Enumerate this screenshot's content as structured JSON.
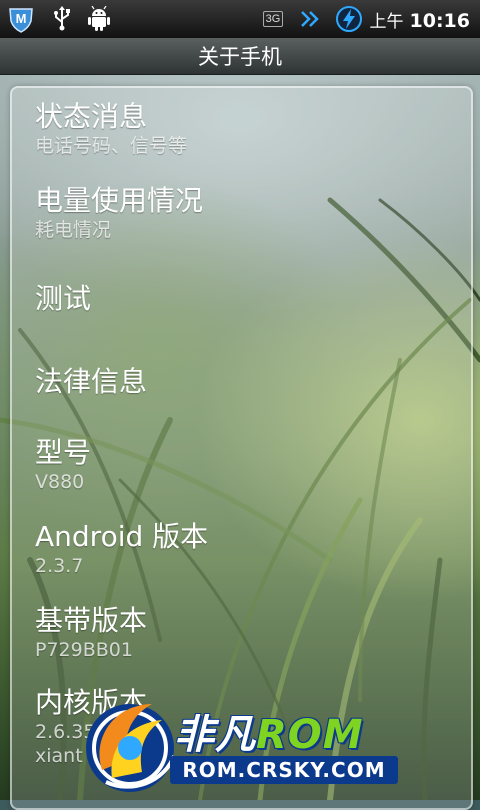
{
  "status_bar": {
    "network_label": "3G",
    "clock_ampm": "上午",
    "clock_time": "10:16",
    "icons": [
      "security-m-icon",
      "usb-icon",
      "android-debug-icon",
      "3g-signal-icon",
      "data-arrows-icon",
      "battery-charging-icon"
    ]
  },
  "title_bar": {
    "title": "关于手机"
  },
  "list": {
    "items": [
      {
        "title": "状态消息",
        "subtitle": "电话号码、信号等"
      },
      {
        "title": "电量使用情况",
        "subtitle": "耗电情况"
      },
      {
        "title": "测试",
        "subtitle": ""
      },
      {
        "title": "法律信息",
        "subtitle": ""
      },
      {
        "title": "型号",
        "subtitle": "V880"
      },
      {
        "title": "Android 版本",
        "subtitle": "2.3.7"
      },
      {
        "title": "基带版本",
        "subtitle": "P729BB01"
      },
      {
        "title": "内核版本",
        "subtitle": "2.6.35",
        "subtitle2": "xiant"
      }
    ]
  },
  "watermark": {
    "brand_cn": "非凡",
    "brand_en": "ROM",
    "url": "ROM.CRSKY.COM"
  },
  "colors": {
    "status_bar_bg": "#111111",
    "title_bar_bg": "#3a4040",
    "watermark_blue": "#0b3a8c",
    "watermark_green": "#7fd321"
  }
}
